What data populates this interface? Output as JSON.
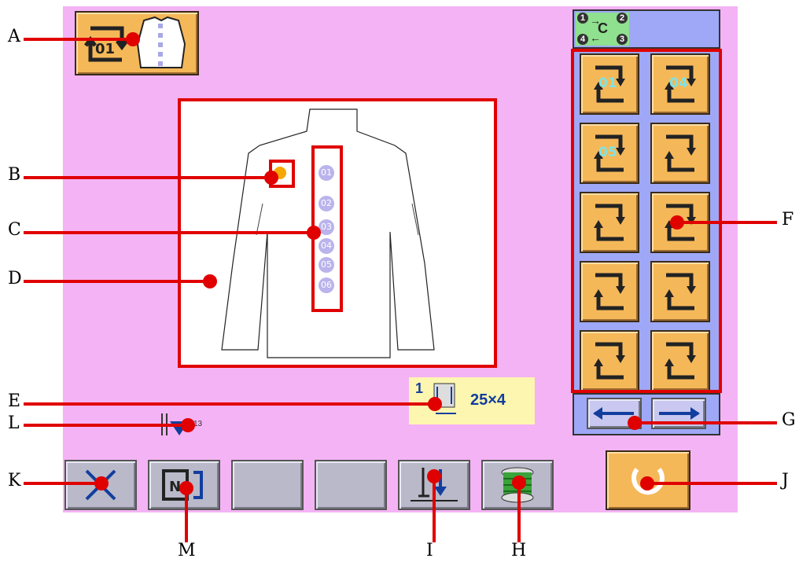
{
  "callouts": {
    "A": "A",
    "B": "B",
    "C": "C",
    "D": "D",
    "E": "E",
    "L": "L",
    "K": "K",
    "F": "F",
    "G": "G",
    "J": "J",
    "M": "M",
    "I": "I",
    "H": "H"
  },
  "header_button": {
    "number": "01"
  },
  "positions": [
    "01",
    "02",
    "03",
    "04",
    "05",
    "06"
  ],
  "grid": {
    "order_legend": [
      "1",
      "2",
      "3",
      "4"
    ],
    "order_center": "C",
    "cells": [
      "01",
      "04",
      "05",
      "",
      "",
      "",
      "",
      "",
      "",
      ""
    ]
  },
  "size_panel": {
    "number": "1",
    "value": "25×4"
  },
  "thread_counter": "13",
  "stitch_button": {
    "label": "N"
  },
  "colors": {
    "screen": "#f4b3f4",
    "button": "#f5b859",
    "callout": "#e00000",
    "gray": "#b9b9c9"
  }
}
